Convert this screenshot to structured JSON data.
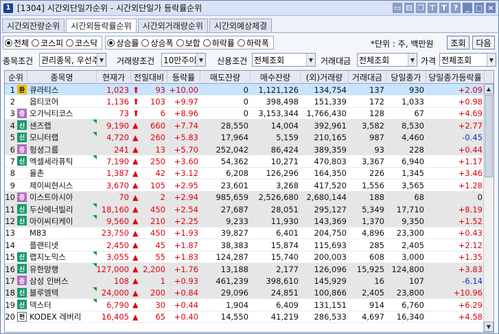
{
  "window": {
    "number": "1",
    "title": "[1304] 시간외단일가순위 - 시간외단일가 등락률순위",
    "title_icons": [
      "message-icon",
      "restore-icon",
      "copy-icon",
      "pin-icon",
      "text-icon",
      "help-icon",
      "minimize-icon",
      "maximize-icon",
      "close-icon"
    ]
  },
  "tabs": [
    {
      "label": "시간외잔량순위",
      "active": false
    },
    {
      "label": "시간외등락률순위",
      "active": true
    },
    {
      "label": "시간외거래량순위",
      "active": false
    },
    {
      "label": "시간외예상체결",
      "active": false
    }
  ],
  "market_radios": [
    {
      "label": "전체",
      "selected": true
    },
    {
      "label": "코스피",
      "selected": false
    },
    {
      "label": "코스닥",
      "selected": false
    }
  ],
  "type_radios": [
    {
      "label": "상승률",
      "selected": true
    },
    {
      "label": "상승폭",
      "selected": false
    },
    {
      "label": "보합",
      "selected": false
    },
    {
      "label": "하락률",
      "selected": false
    },
    {
      "label": "하락폭",
      "selected": false
    }
  ],
  "unit_text": "*단위 : 주, 백만원",
  "buttons": {
    "query": "조회",
    "next": "다음"
  },
  "filters": {
    "stock_cond_label": "종목조건",
    "stock_cond_value": "관리종목, 우선주",
    "volume_cond_label": "거래량조건",
    "volume_cond_value": "10만주이상",
    "credit_cond_label": "신용조건",
    "credit_cond_value": "전체조회",
    "amount_label": "거래대금",
    "amount_value": "전체조회",
    "price_label": "가격",
    "price_value": "전체조회"
  },
  "table": {
    "headers": [
      "순위",
      "종목명",
      "현재가",
      "전일대비",
      "등락률",
      "매도잔량",
      "매수잔량",
      "(외)거래량",
      "거래대금",
      "당일종가",
      "당일종가등락률"
    ],
    "rows": [
      {
        "rank": "1",
        "badge": "환",
        "badge_color": "#f0c000",
        "name": "큐라티스",
        "price": "1,023",
        "change": "93",
        "mark": "up-arrow",
        "rate": "+10.00",
        "sell": "0",
        "buy": "1,121,126",
        "volume": "134,754",
        "amount": "137",
        "close": "930",
        "close_rate": "+2.09",
        "close_rate_dir": "up"
      },
      {
        "rank": "2",
        "badge": "",
        "badge_color": "",
        "name": "옵티코어",
        "price": "1,136",
        "change": "103",
        "mark": "up-arrow",
        "rate": "+9.97",
        "sell": "0",
        "buy": "398,498",
        "volume": "151,339",
        "amount": "172",
        "close": "1,033",
        "close_rate": "+0.98",
        "close_rate_dir": "up"
      },
      {
        "rank": "3",
        "badge": "증",
        "badge_color": "#b070c0",
        "name": "오가닉티코스",
        "price": "73",
        "change": "6",
        "mark": "up-arrow",
        "rate": "+8.96",
        "sell": "0",
        "buy": "3,153,344",
        "volume": "1,766,430",
        "amount": "128",
        "close": "67",
        "close_rate": "+4.69",
        "close_rate_dir": "up"
      },
      {
        "rank": "4",
        "badge": "신",
        "badge_color": "#1a9a6a",
        "name": "샌즈랩",
        "price": "9,190",
        "change": "660",
        "mark": "up-tri",
        "rate": "+7.74",
        "sell": "28,550",
        "buy": "14,004",
        "volume": "392,961",
        "amount": "3,582",
        "close": "8,530",
        "close_rate": "+2.77",
        "close_rate_dir": "up"
      },
      {
        "rank": "5",
        "badge": "신",
        "badge_color": "#1a9a6a",
        "name": "모니터랩",
        "price": "4,720",
        "change": "260",
        "mark": "up-tri",
        "rate": "+5.83",
        "sell": "17,964",
        "buy": "5,159",
        "volume": "210,165",
        "amount": "987",
        "close": "4,460",
        "close_rate": "-0.45",
        "close_rate_dir": "down"
      },
      {
        "rank": "6",
        "badge": "증",
        "badge_color": "#b070c0",
        "name": "헝셩그룹",
        "price": "241",
        "change": "13",
        "mark": "up-tri",
        "rate": "+5.70",
        "sell": "252,042",
        "buy": "86,424",
        "volume": "389,359",
        "amount": "93",
        "close": "228",
        "close_rate": "+0.44",
        "close_rate_dir": "up"
      },
      {
        "rank": "7",
        "badge": "신",
        "badge_color": "#1a9a6a",
        "name": "엑셀세라퓨틱",
        "price": "7,190",
        "change": "250",
        "mark": "up-tri",
        "rate": "+3.60",
        "sell": "54,362",
        "buy": "10,271",
        "volume": "470,803",
        "amount": "3,367",
        "close": "6,940",
        "close_rate": "+1.17",
        "close_rate_dir": "up"
      },
      {
        "rank": "8",
        "badge": "",
        "badge_color": "",
        "name": "율촌",
        "price": "1,387",
        "change": "42",
        "mark": "up-tri",
        "rate": "+3.12",
        "sell": "6,208",
        "buy": "126,296",
        "volume": "164,350",
        "amount": "226",
        "close": "1,345",
        "close_rate": "+3.46",
        "close_rate_dir": "up"
      },
      {
        "rank": "9",
        "badge": "",
        "badge_color": "",
        "name": "제이씨현시스",
        "price": "3,670",
        "change": "105",
        "mark": "up-tri",
        "rate": "+2.95",
        "sell": "23,601",
        "buy": "3,268",
        "volume": "417,520",
        "amount": "1,556",
        "close": "3,565",
        "close_rate": "+1.28",
        "close_rate_dir": "up"
      },
      {
        "rank": "10",
        "badge": "증",
        "badge_color": "#b070c0",
        "name": "이스트아시아",
        "price": "70",
        "change": "2",
        "mark": "up-tri",
        "rate": "+2.94",
        "sell": "985,659",
        "buy": "2,526,680",
        "volume": "2,680,144",
        "amount": "188",
        "close": "68",
        "close_rate": "0",
        "close_rate_dir": "flat"
      },
      {
        "rank": "11",
        "badge": "신",
        "badge_color": "#1a9a6a",
        "name": "두산에너빌리",
        "price": "18,160",
        "change": "450",
        "mark": "up-tri",
        "rate": "+2.54",
        "sell": "27,687",
        "buy": "28,051",
        "volume": "295,127",
        "amount": "5,349",
        "close": "17,710",
        "close_rate": "+8.19",
        "close_rate_dir": "up"
      },
      {
        "rank": "12",
        "badge": "신",
        "badge_color": "#1a9a6a",
        "name": "아이씨티케이",
        "price": "9,560",
        "change": "210",
        "mark": "up-tri",
        "rate": "+2.25",
        "sell": "9,233",
        "buy": "11,930",
        "volume": "143,369",
        "amount": "1,370",
        "close": "9,350",
        "close_rate": "+1.52",
        "close_rate_dir": "up"
      },
      {
        "rank": "13",
        "badge": "",
        "badge_color": "",
        "name": "M83",
        "price": "23,750",
        "change": "450",
        "mark": "up-tri",
        "rate": "+1.93",
        "sell": "39,827",
        "buy": "6,401",
        "volume": "204,750",
        "amount": "4,896",
        "close": "23,300",
        "close_rate": "+0.43",
        "close_rate_dir": "up"
      },
      {
        "rank": "14",
        "badge": "",
        "badge_color": "",
        "name": "플랜티넷",
        "price": "2,450",
        "change": "45",
        "mark": "up-tri",
        "rate": "+1.87",
        "sell": "38,383",
        "buy": "15,874",
        "volume": "115,693",
        "amount": "285",
        "close": "2,405",
        "close_rate": "+2.12",
        "close_rate_dir": "up"
      },
      {
        "rank": "15",
        "badge": "신",
        "badge_color": "#1a9a6a",
        "name": "랩지노믹스",
        "price": "3,055",
        "change": "55",
        "mark": "up-tri",
        "rate": "+1.83",
        "sell": "124,287",
        "buy": "15,740",
        "volume": "200,003",
        "amount": "608",
        "close": "3,000",
        "close_rate": "+1.35",
        "close_rate_dir": "up"
      },
      {
        "rank": "16",
        "badge": "신",
        "badge_color": "#1a9a6a",
        "name": "유한양행",
        "price": "127,000",
        "change": "2,200",
        "mark": "up-tri",
        "rate": "+1.76",
        "sell": "13,188",
        "buy": "2,177",
        "volume": "126,096",
        "amount": "15,925",
        "close": "124,800",
        "close_rate": "+3.83",
        "close_rate_dir": "up"
      },
      {
        "rank": "17",
        "badge": "증",
        "badge_color": "#b070c0",
        "name": "삼성 인버스",
        "price": "108",
        "change": "1",
        "mark": "up-tri",
        "rate": "+0.93",
        "sell": "461,239",
        "buy": "398,610",
        "volume": "145,929",
        "amount": "16",
        "close": "107",
        "close_rate": "-6.14",
        "close_rate_dir": "down"
      },
      {
        "rank": "18",
        "badge": "신",
        "badge_color": "#1a9a6a",
        "name": "블루엠텍",
        "price": "24,000",
        "change": "200",
        "mark": "up-tri",
        "rate": "+0.84",
        "sell": "29,096",
        "buy": "24,851",
        "volume": "100,866",
        "amount": "2,405",
        "close": "23,800",
        "close_rate": "+10.96",
        "close_rate_dir": "up"
      },
      {
        "rank": "19",
        "badge": "신",
        "badge_color": "#1a9a6a",
        "name": "덱스터",
        "price": "6,790",
        "change": "30",
        "mark": "up-tri",
        "rate": "+0.44",
        "sell": "1,904",
        "buy": "6,409",
        "volume": "131,151",
        "amount": "914",
        "close": "6,760",
        "close_rate": "+6.29",
        "close_rate_dir": "up"
      },
      {
        "rank": "20",
        "badge": "펀",
        "badge_color": "#ffffff",
        "name": "KODEX 레버리",
        "price": "16,405",
        "change": "65",
        "mark": "up-tri",
        "rate": "+0.40",
        "sell": "14,550",
        "buy": "41,219",
        "volume": "286,533",
        "amount": "4,697",
        "close": "16,340",
        "close_rate": "+4.58",
        "close_rate_dir": "up"
      }
    ]
  }
}
